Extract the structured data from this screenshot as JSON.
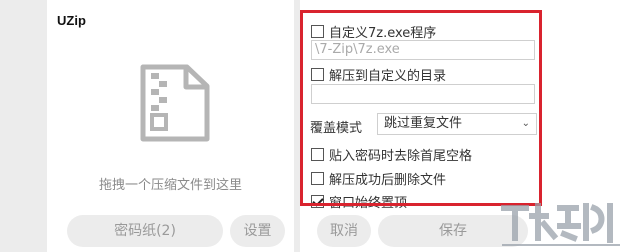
{
  "app": {
    "title": "UZip"
  },
  "drop": {
    "hint": "拖拽一个压缩文件到这里"
  },
  "buttons": {
    "password": "密码纸(2)",
    "settings": "设置",
    "cancel": "取消",
    "save": "保存"
  },
  "options": {
    "custom_7z_label": "自定义7z.exe程序",
    "custom_7z_path": "\\7-Zip\\7z.exe",
    "custom_dir_label": "解压到自定义的目录",
    "custom_dir_value": "",
    "overwrite_mode_label": "覆盖模式",
    "overwrite_mode_value": "跳过重复文件",
    "trim_password_label": "贴入密码时去除首尾空格",
    "delete_after_label": "解压成功后删除文件",
    "always_on_top_label": "窗口始终置顶"
  },
  "checks": {
    "custom_7z": false,
    "custom_dir": false,
    "trim_password": false,
    "delete_after": false,
    "always_on_top": true
  },
  "colors": {
    "highlight_border": "#d9232e",
    "panel_bg": "#ffffff",
    "button_bg": "#ececec"
  }
}
